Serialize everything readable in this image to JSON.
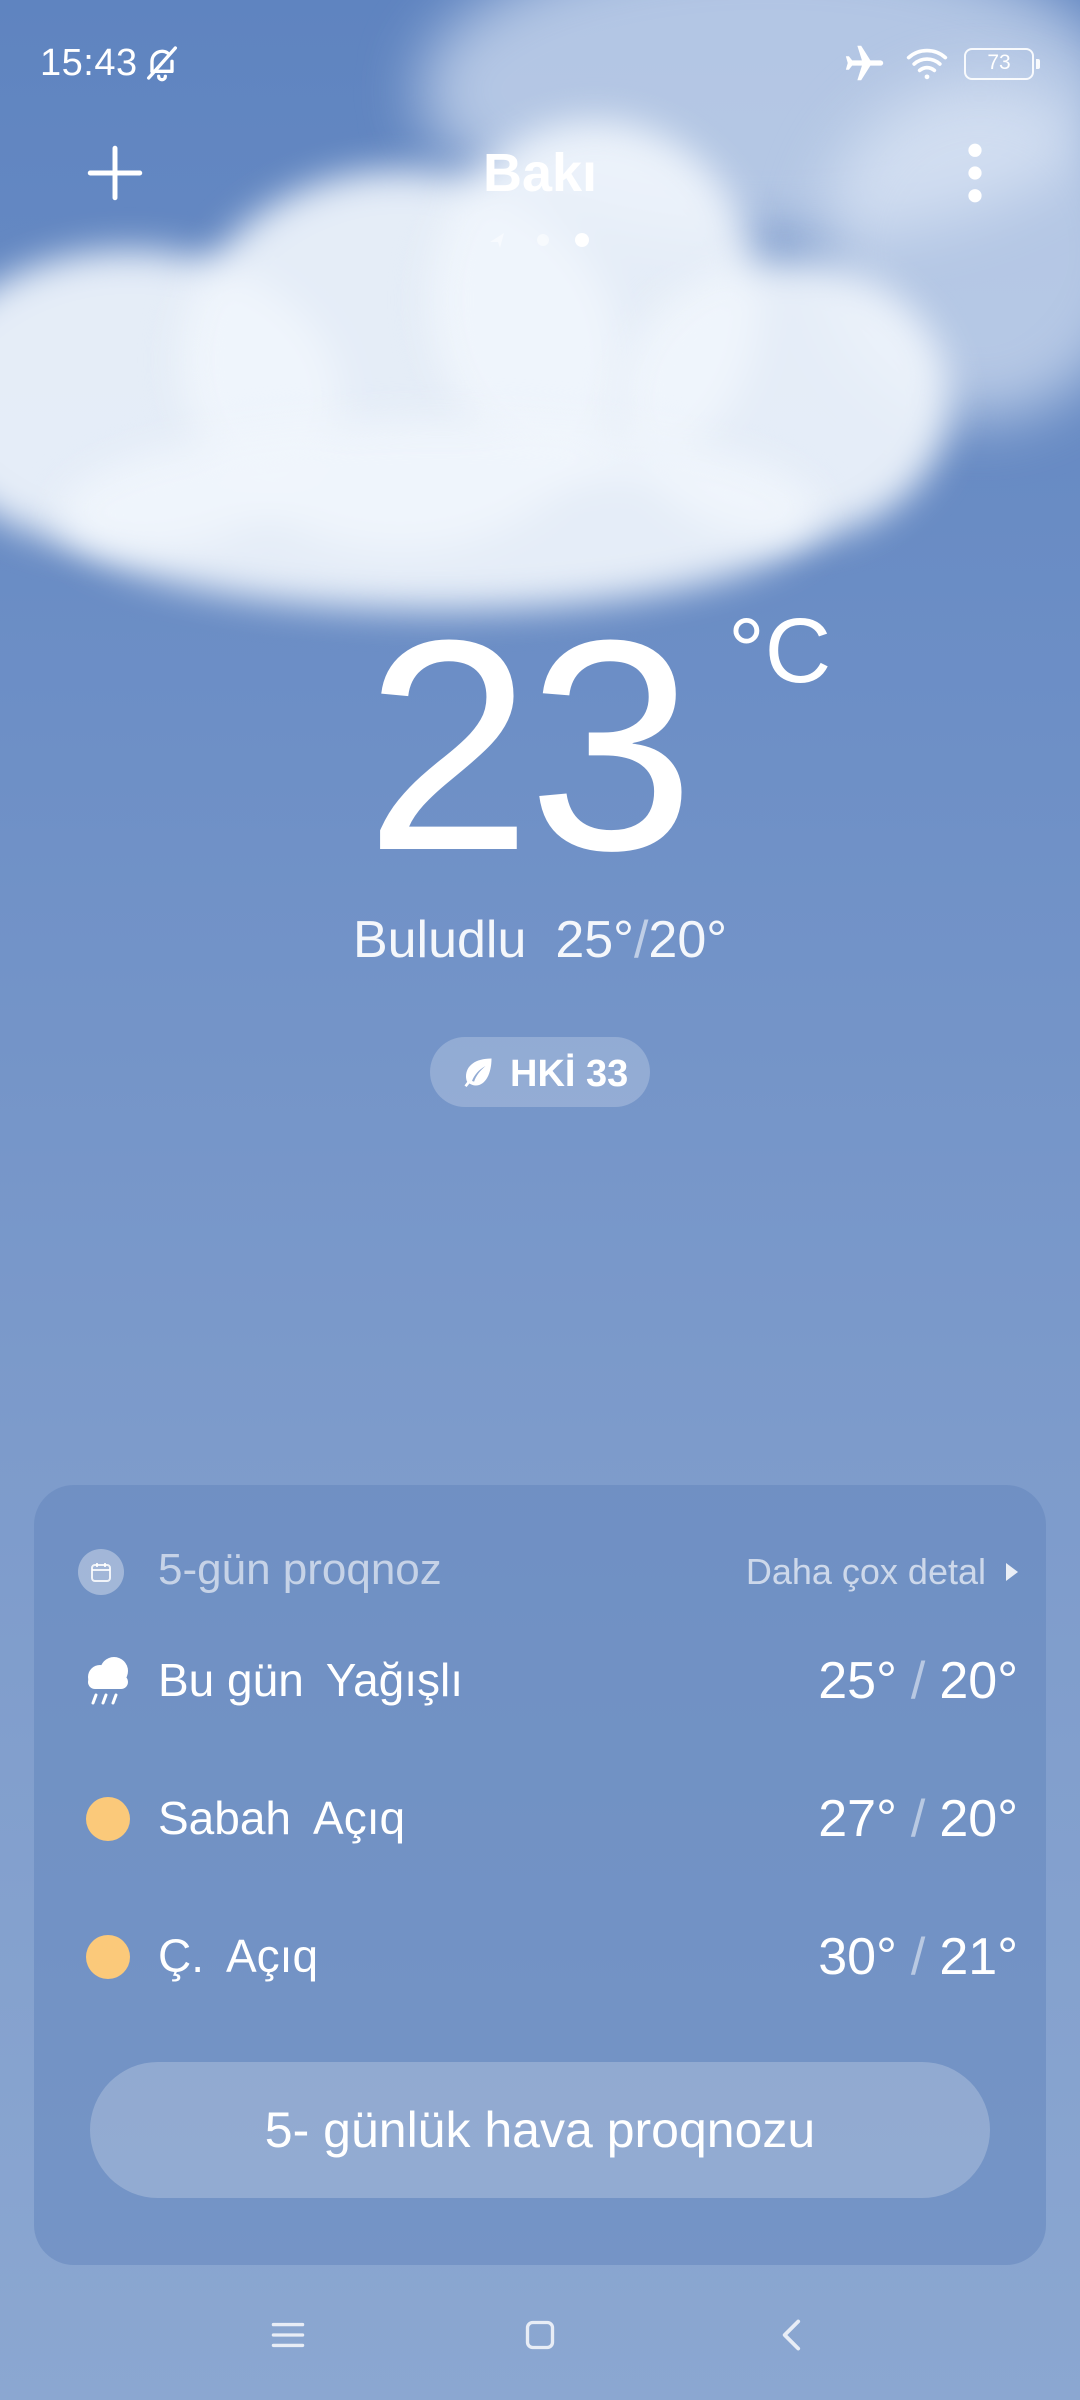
{
  "status_bar": {
    "time": "15:43",
    "battery": "73",
    "icons": [
      "bell-muted-icon",
      "airplane-icon",
      "wifi-icon",
      "battery-icon"
    ]
  },
  "header": {
    "city": "Bakı",
    "page_dots": 3,
    "active_dot": 2,
    "icons": [
      "plus-icon",
      "more-vertical-icon"
    ]
  },
  "current": {
    "temperature": "23",
    "unit": "°C",
    "condition": "Buludlu",
    "high": "25°",
    "low": "20°",
    "aqi_label": "HKİ 33"
  },
  "forecast_card": {
    "title": "5-gün proqnoz",
    "more_link": "Daha çox detal",
    "days": [
      {
        "day": "Bu gün",
        "desc": "Yağışlı",
        "high": "25°",
        "low": "20°",
        "icon": "rain-cloud-icon"
      },
      {
        "day": "Sabah",
        "desc": "Açıq",
        "high": "27°",
        "low": "20°",
        "icon": "sun-icon"
      },
      {
        "day": "Ç.",
        "desc": "Açıq",
        "high": "30°",
        "low": "21°",
        "icon": "sun-icon"
      }
    ],
    "button": "5- günlük hava proqnozu"
  },
  "nav_bar": {
    "icons": [
      "menu-icon",
      "home-icon",
      "back-icon"
    ]
  },
  "colors": {
    "sky_top": "#5f84c0",
    "sky_bottom": "#8ba7d1",
    "sun": "#fbc97a",
    "text": "#ffffff"
  }
}
